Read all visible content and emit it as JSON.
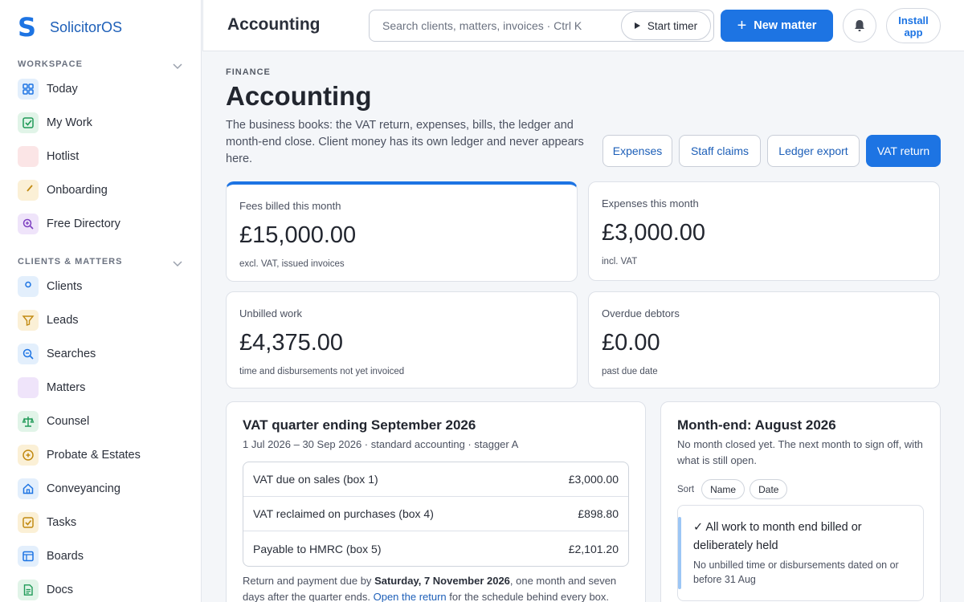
{
  "app": {
    "name": "SolicitorOS"
  },
  "sidebar": {
    "sections": [
      {
        "label": "WORKSPACE"
      },
      {
        "label": "CLIENTS & MATTERS"
      }
    ],
    "workspace_items": [
      {
        "label": "Today",
        "icon": "grid-icon",
        "color": "#1d74e3",
        "bg": "#e3effc"
      },
      {
        "label": "My Work",
        "icon": "check-square-icon",
        "color": "#1f9a57",
        "bg": "#e1f4e8"
      },
      {
        "label": "Hotlist",
        "icon": "flame-icon",
        "color": "#d8383f",
        "bg": "#fbe5e6"
      },
      {
        "label": "Onboarding",
        "icon": "brush-icon",
        "color": "#c28a12",
        "bg": "#fbf0d6"
      },
      {
        "label": "Free Directory",
        "icon": "search-plus-icon",
        "color": "#7d3fc1",
        "bg": "#efe4fa"
      }
    ],
    "matter_items": [
      {
        "label": "Clients",
        "icon": "user-icon",
        "color": "#1d74e3",
        "bg": "#e3effc"
      },
      {
        "label": "Leads",
        "icon": "filter-icon",
        "color": "#c28a12",
        "bg": "#fbf0d6"
      },
      {
        "label": "Searches",
        "icon": "search-minus-icon",
        "color": "#1d74e3",
        "bg": "#e3effc"
      },
      {
        "label": "Matters",
        "icon": "folder-icon",
        "color": "#7d3fc1",
        "bg": "#efe4fa"
      },
      {
        "label": "Counsel",
        "icon": "scales-icon",
        "color": "#1f9a57",
        "bg": "#e1f4e8"
      },
      {
        "label": "Probate & Estates",
        "icon": "plus-circle-icon",
        "color": "#c28a12",
        "bg": "#fbf0d6"
      },
      {
        "label": "Conveyancing",
        "icon": "home-icon",
        "color": "#1d74e3",
        "bg": "#e3effc"
      },
      {
        "label": "Tasks",
        "icon": "checkbox-icon",
        "color": "#c28a12",
        "bg": "#fbf0d6"
      },
      {
        "label": "Boards",
        "icon": "board-icon",
        "color": "#1d74e3",
        "bg": "#e3effc"
      },
      {
        "label": "Docs",
        "icon": "document-icon",
        "color": "#1f9a57",
        "bg": "#e1f4e8"
      }
    ]
  },
  "header": {
    "title": "Accounting",
    "search_placeholder": "Search clients, matters, invoices · Ctrl K",
    "timer_label": "Start timer",
    "new_label": "New matter",
    "install_label_1": "Install",
    "install_label_2": "app"
  },
  "page": {
    "eyebrow": "FINANCE",
    "title": "Accounting",
    "description": "The business books: the VAT return, expenses, bills, the ledger and month-end close. Client money has its own ledger and never appears here.",
    "actions": [
      "Expenses",
      "Staff claims",
      "Ledger export",
      "VAT return"
    ]
  },
  "stats": [
    {
      "label": "Fees billed this month",
      "value": "£15,000.00",
      "sub": "excl. VAT, issued invoices"
    },
    {
      "label": "Expenses this month",
      "value": "£3,000.00",
      "sub": "incl. VAT"
    },
    {
      "label": "Unbilled work",
      "value": "£4,375.00",
      "sub": "time and disbursements not yet invoiced"
    },
    {
      "label": "Overdue debtors",
      "value": "£0.00",
      "sub": "past due date"
    }
  ],
  "vat": {
    "title": "VAT quarter ending September 2026",
    "subtitle": "1 Jul 2026 – 30 Sep 2026 · standard accounting · stagger A",
    "rows": [
      {
        "label": "VAT due on sales (box 1)",
        "value": "£3,000.00"
      },
      {
        "label": "VAT reclaimed on purchases (box 4)",
        "value": "£898.80"
      },
      {
        "label": "Payable to HMRC (box 5)",
        "value": "£2,101.20"
      }
    ],
    "footer_prefix": "Return and payment due by ",
    "footer_date": "Saturday, 7 November 2026",
    "footer_mid": ", one month and seven days after the quarter ends. ",
    "footer_link": "Open the return",
    "footer_suffix": " for the schedule behind every box."
  },
  "monthend": {
    "title": "Month-end: August 2026",
    "subtitle": "No month closed yet. The next month to sign off, with what is still open.",
    "sort_label": "Sort",
    "sort_options": [
      "Name",
      "Date"
    ],
    "check_title": "✓ All work to month end billed or deliberately held",
    "check_sub": "No unbilled time or disbursements dated on or before 31 Aug"
  }
}
